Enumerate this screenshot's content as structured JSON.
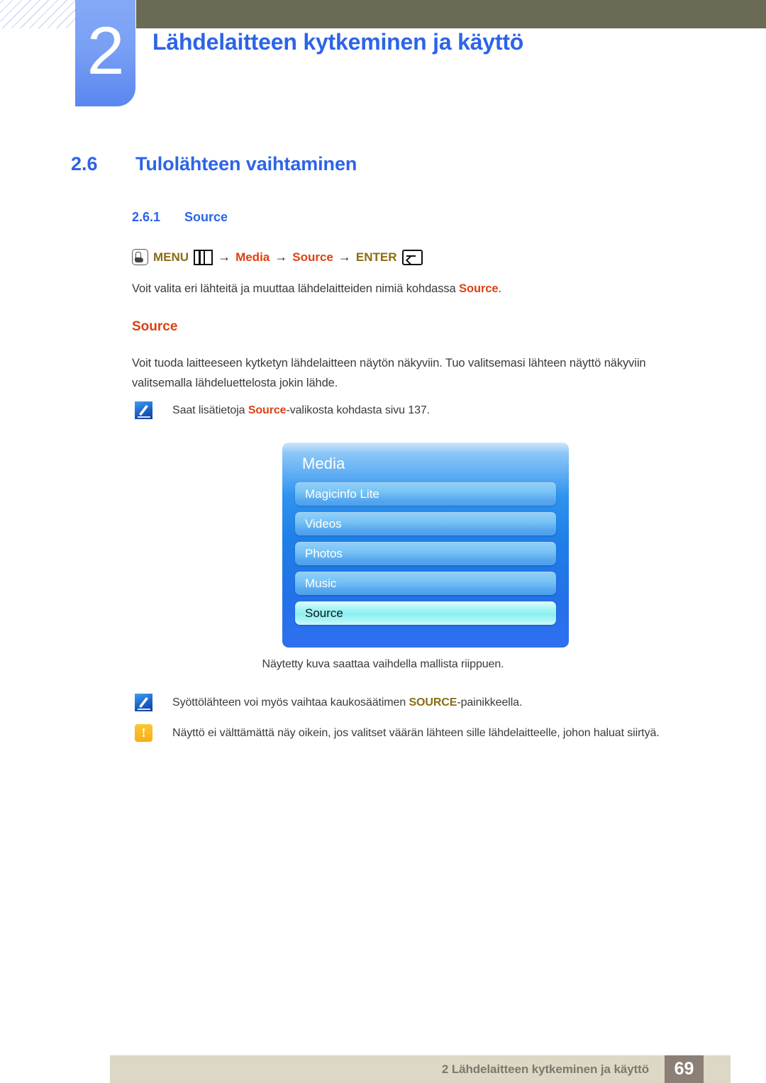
{
  "header": {
    "chapter_number": "2",
    "chapter_title": "Lähdelaitteen kytkeminen ja käyttö"
  },
  "section": {
    "number": "2.6",
    "title": "Tulolähteen vaihtaminen"
  },
  "subsection": {
    "number": "2.6.1",
    "title": "Source"
  },
  "menu_path": {
    "hand_icon": "hand-press-icon",
    "menu_label": "MENU",
    "menu_bars_icon": "menu-bars-icon",
    "arrow1": "→",
    "step1": "Media",
    "arrow2": "→",
    "step2": "Source",
    "arrow3": "→",
    "enter_label": "ENTER",
    "enter_icon": "enter-return-icon"
  },
  "intro_paragraph": {
    "before": "Voit valita eri lähteitä ja muuttaa lähdelaitteiden nimiä kohdassa ",
    "highlight": "Source",
    "after": "."
  },
  "sub_head": "Source",
  "body_paragraph": "Voit tuoda laitteeseen kytketyn lähdelaitteen näytön näkyviin. Tuo valitsemasi lähteen näyttö näkyviin valitsemalla lähdeluettelosta jokin lähde.",
  "notes": [
    {
      "icon": "note-pen-icon",
      "before": "Saat lisätietoja ",
      "highlight": "Source",
      "after": "-valikosta kohdasta sivu 137."
    },
    {
      "icon": "note-pen-icon",
      "before": "Syöttölähteen voi myös vaihtaa kaukosäätimen ",
      "highlight": "SOURCE",
      "after": "-painikkeella."
    },
    {
      "icon": "warning-icon",
      "before": "Näyttö ei välttämättä näy oikein, jos valitset väärän lähteen sille lähdelaitteelle, johon haluat siirtyä.",
      "highlight": "",
      "after": ""
    }
  ],
  "osd": {
    "title": "Media",
    "items": [
      {
        "label": "Magicinfo Lite",
        "selected": false
      },
      {
        "label": "Videos",
        "selected": false
      },
      {
        "label": "Photos",
        "selected": false
      },
      {
        "label": "Music",
        "selected": false
      },
      {
        "label": "Source",
        "selected": true
      }
    ],
    "caption": "Näytetty kuva saattaa vaihdella mallista riippuen."
  },
  "footer": {
    "text": "2 Lähdelaitteen kytkeminen ja käyttö",
    "page": "69"
  },
  "colors": {
    "heading_blue": "#2c64e8",
    "accent_red": "#dd4111",
    "accent_gold": "#8a6c13",
    "olive_bar": "#6b6a55",
    "footer_bar": "#ddd7c5",
    "footer_page_box": "#8b7f76"
  }
}
